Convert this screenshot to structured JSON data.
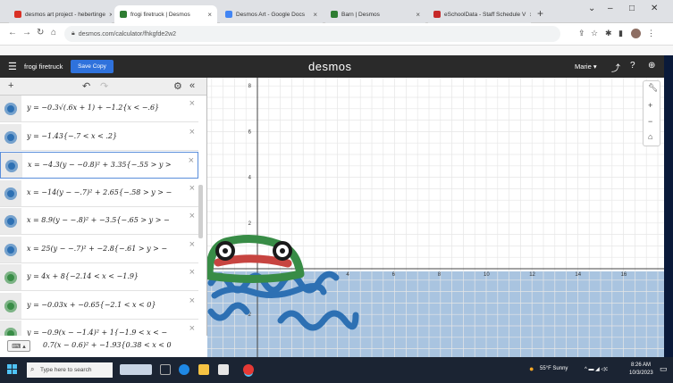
{
  "browser": {
    "tabs": [
      {
        "label": "desmos art project - hebertinge",
        "favicon_color": "#d93025",
        "active": false
      },
      {
        "label": "frogi firetruck | Desmos",
        "favicon_color": "#2e7d32",
        "active": true
      },
      {
        "label": "Desmos Art - Google Docs",
        "favicon_color": "#4285f4",
        "active": false
      },
      {
        "label": "Barn | Desmos",
        "favicon_color": "#2e7d32",
        "active": false
      },
      {
        "label": "eSchoolData - Staff Schedule V",
        "favicon_color": "#c62828",
        "active": false
      }
    ],
    "url": "desmos.com/calculator/fhkgfde2w2"
  },
  "header": {
    "graph_name": "frogi firetruck",
    "save_label": "Save Copy",
    "logo": "desmos",
    "user": "Marie"
  },
  "expressions": [
    {
      "num": "",
      "latex": "y = −0.3√(.6x + 1)  + −1.2{x < −.6}",
      "color": "#2d70b3",
      "type": "wave"
    },
    {
      "num": "",
      "latex": "y = −1.43{−.7 < x < .2}",
      "color": "#2d70b3",
      "type": "wave"
    },
    {
      "num": "",
      "latex": "x = −4.3(y − −0.8)² + 3.35{−.55 > y >",
      "color": "#2d70b3",
      "type": "wave",
      "selected": true
    },
    {
      "num": "",
      "latex": "x = −14(y − −.7)² + 2.65{−.58 > y > −",
      "color": "#2d70b3",
      "type": "wave"
    },
    {
      "num": "",
      "latex": "x = 8.9(y − −.8)² + −3.5{−.65 > y > −",
      "color": "#2d70b3",
      "type": "wave"
    },
    {
      "num": "",
      "latex": "x = 25(y − −.7)² + −2.8{−.61 > y > −",
      "color": "#2d70b3",
      "type": "wave"
    },
    {
      "num": "",
      "latex": "y = 4x + 8{−2.14 < x < −1.9}",
      "color": "#388c46",
      "type": "wave"
    },
    {
      "num": "",
      "latex": "y = −0.03x + −0.65{−2.1 < x < 0}",
      "color": "#388c46",
      "type": "wave"
    },
    {
      "num": "",
      "latex": "y = −0.9(x − −1.4)² + 1{−1.9 < x < −",
      "color": "#388c46",
      "type": "wave"
    },
    {
      "num": "",
      "latex": "0.7(x − 0.6)² + −1.93{0.38 < x < 0",
      "color": "#388c46",
      "type": "wave"
    }
  ],
  "graph": {
    "x_ticks": [
      "2",
      "4",
      "6",
      "8",
      "10",
      "12",
      "14",
      "16"
    ],
    "y_ticks": [
      "8",
      "6",
      "4",
      "2",
      "−2"
    ],
    "water_color": "#a9c4e0"
  },
  "taskbar": {
    "search_placeholder": "Type here to search",
    "weather": "55°F  Sunny",
    "time": "8:26 AM",
    "date": "10/3/2023"
  }
}
